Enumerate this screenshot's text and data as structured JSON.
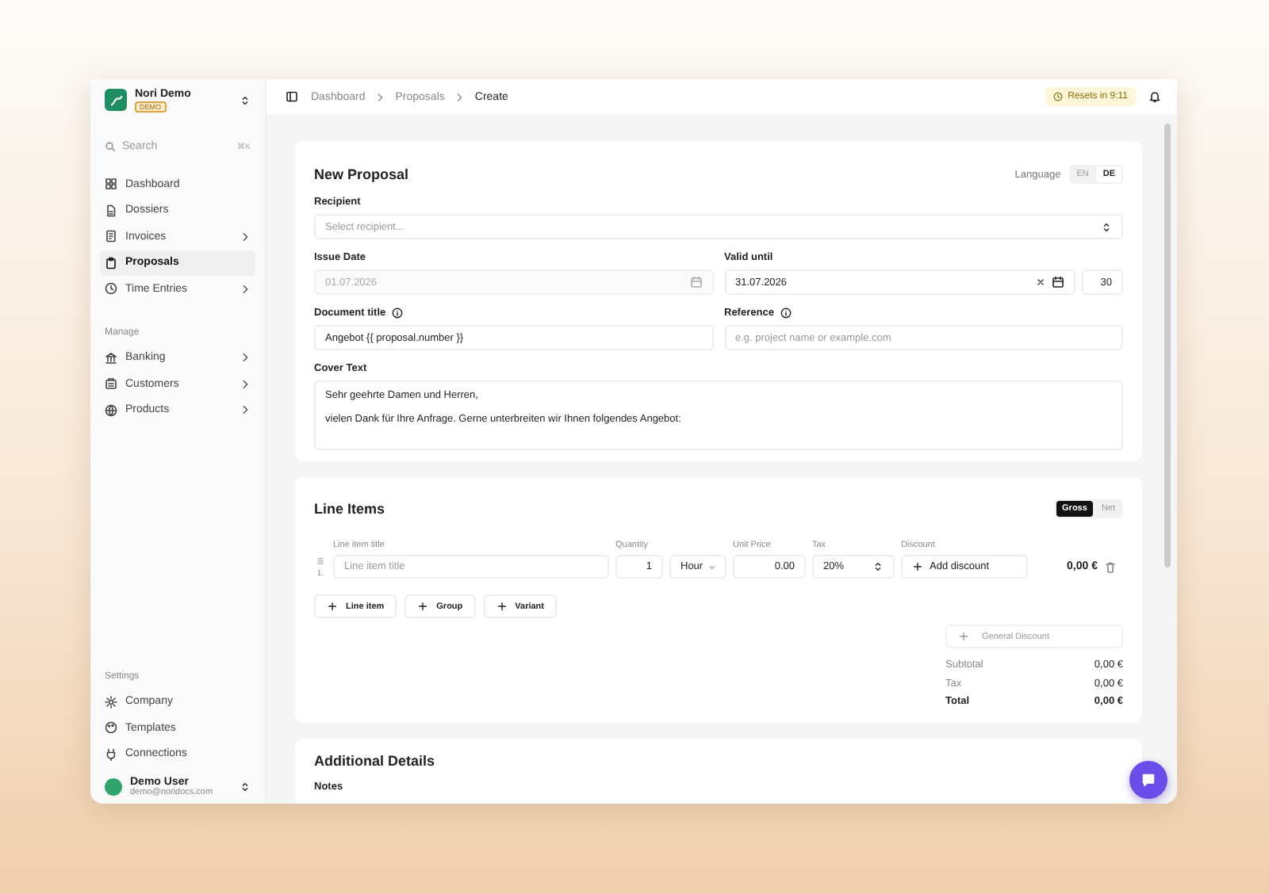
{
  "sidebar": {
    "brand": {
      "name": "Nori Demo",
      "badge": "DEMO"
    },
    "search": {
      "placeholder": "Search",
      "shortcut": "⌘K"
    },
    "groups": [
      {
        "items": [
          {
            "label": "Dashboard",
            "selected": false,
            "expandable": false
          },
          {
            "label": "Dossiers",
            "selected": false,
            "expandable": false
          },
          {
            "label": "Invoices",
            "selected": false,
            "expandable": true
          },
          {
            "label": "Proposals",
            "selected": true,
            "expandable": false
          },
          {
            "label": "Time Entries",
            "selected": false,
            "expandable": true
          }
        ]
      },
      {
        "label": "Manage",
        "items": [
          {
            "label": "Banking",
            "selected": false,
            "expandable": true
          },
          {
            "label": "Customers",
            "selected": false,
            "expandable": true
          },
          {
            "label": "Products",
            "selected": false,
            "expandable": true
          }
        ]
      }
    ],
    "settings": {
      "label": "Settings",
      "items": [
        {
          "label": "Company",
          "selected": false,
          "expandable": false
        },
        {
          "label": "Templates",
          "selected": false,
          "expandable": false
        },
        {
          "label": "Connections",
          "selected": false,
          "expandable": false
        }
      ]
    },
    "user": {
      "name": "Demo User",
      "email": "demo@noridocs.com"
    }
  },
  "header": {
    "breadcrumb": [
      "Dashboard",
      "Proposals",
      "Create"
    ],
    "reset_badge": "Resets in 9:11"
  },
  "proposal": {
    "title": "New Proposal",
    "language": {
      "label": "Language",
      "options": [
        {
          "label": "EN",
          "selected": false
        },
        {
          "label": "DE",
          "selected": true
        }
      ]
    },
    "recipient": {
      "label": "Recipient",
      "placeholder": "Select recipient..."
    },
    "issue_date": {
      "label": "Issue Date",
      "value": "01.07.2026",
      "disabled": true
    },
    "valid_until": {
      "label": "Valid until",
      "value": "31.07.2026",
      "days": "30"
    },
    "document_title": {
      "label": "Document title",
      "value": "Angebot {{ proposal.number }}"
    },
    "reference": {
      "label": "Reference",
      "placeholder": "e.g. project name or example.com"
    },
    "cover_text": {
      "label": "Cover Text",
      "lines": [
        "Sehr geehrte Damen und Herren,",
        "vielen Dank für Ihre Anfrage. Gerne unterbreiten wir Ihnen folgendes Angebot:"
      ]
    }
  },
  "line_items": {
    "title": "Line Items",
    "price_mode": [
      {
        "label": "Gross",
        "selected": true
      },
      {
        "label": "Net",
        "selected": false
      }
    ],
    "columns": [
      "Line item title",
      "Quantity",
      "Unit Price",
      "Tax",
      "Discount"
    ],
    "rows": [
      {
        "index": "1.",
        "title_placeholder": "Line item title",
        "quantity": "1",
        "unit": "Hour",
        "unit_price": "0.00",
        "tax": "20%",
        "discount_placeholder": "Add discount",
        "total": "0,00 €"
      }
    ],
    "add_buttons": [
      "Line item",
      "Group",
      "Variant"
    ],
    "general_discount": "General Discount",
    "totals": [
      {
        "label": "Subtotal",
        "value": "0,00 €",
        "kind": "line"
      },
      {
        "label": "Tax",
        "value": "0,00 €",
        "kind": "line"
      },
      {
        "label": "Total",
        "value": "0,00 €",
        "kind": "total"
      }
    ]
  },
  "additional": {
    "title": "Additional Details",
    "notes_label": "Notes"
  }
}
